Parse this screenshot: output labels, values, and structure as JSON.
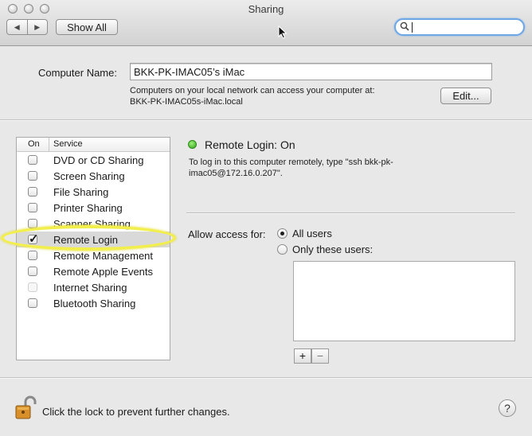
{
  "window": {
    "title": "Sharing"
  },
  "toolbar": {
    "back_icon": "chevron-left-icon",
    "forward_icon": "chevron-right-icon",
    "show_all_label": "Show All",
    "search_placeholder": "",
    "search_icon": "magnifier-icon"
  },
  "computer": {
    "name_label": "Computer Name:",
    "name_value": "BKK-PK-IMAC05’s iMac",
    "info_line1": "Computers on your local network can access your computer at:",
    "info_line2": "BKK-PK-IMAC05s-iMac.local",
    "edit_label": "Edit..."
  },
  "services": {
    "col_on": "On",
    "col_service": "Service",
    "items": [
      {
        "label": "DVD or CD Sharing",
        "checked": false
      },
      {
        "label": "Screen Sharing",
        "checked": false
      },
      {
        "label": "File Sharing",
        "checked": false
      },
      {
        "label": "Printer Sharing",
        "checked": false
      },
      {
        "label": "Scanner Sharing",
        "checked": false
      },
      {
        "label": "Remote Login",
        "checked": true,
        "selected": true
      },
      {
        "label": "Remote Management",
        "checked": false
      },
      {
        "label": "Remote Apple Events",
        "checked": false
      },
      {
        "label": "Internet Sharing",
        "checked": false,
        "disabled": true
      },
      {
        "label": "Bluetooth Sharing",
        "checked": false
      }
    ]
  },
  "detail": {
    "status_color": "#2fa319",
    "status": "Remote Login: On",
    "info_line1": "To log in to this computer remotely, type \"ssh bkk-pk-",
    "info_line2": "imac05@172.16.0.207\".",
    "allow_label": "Allow access for:",
    "option_all": "All users",
    "option_only": "Only these users:",
    "plus": "+",
    "minus": "−"
  },
  "footer": {
    "lock_icon": "padlock-open-icon",
    "lock_text": "Click the lock to prevent further changes.",
    "help": "?"
  },
  "accent": {
    "highlight": "#f2ee4c",
    "focus": "#6fa7e6"
  }
}
